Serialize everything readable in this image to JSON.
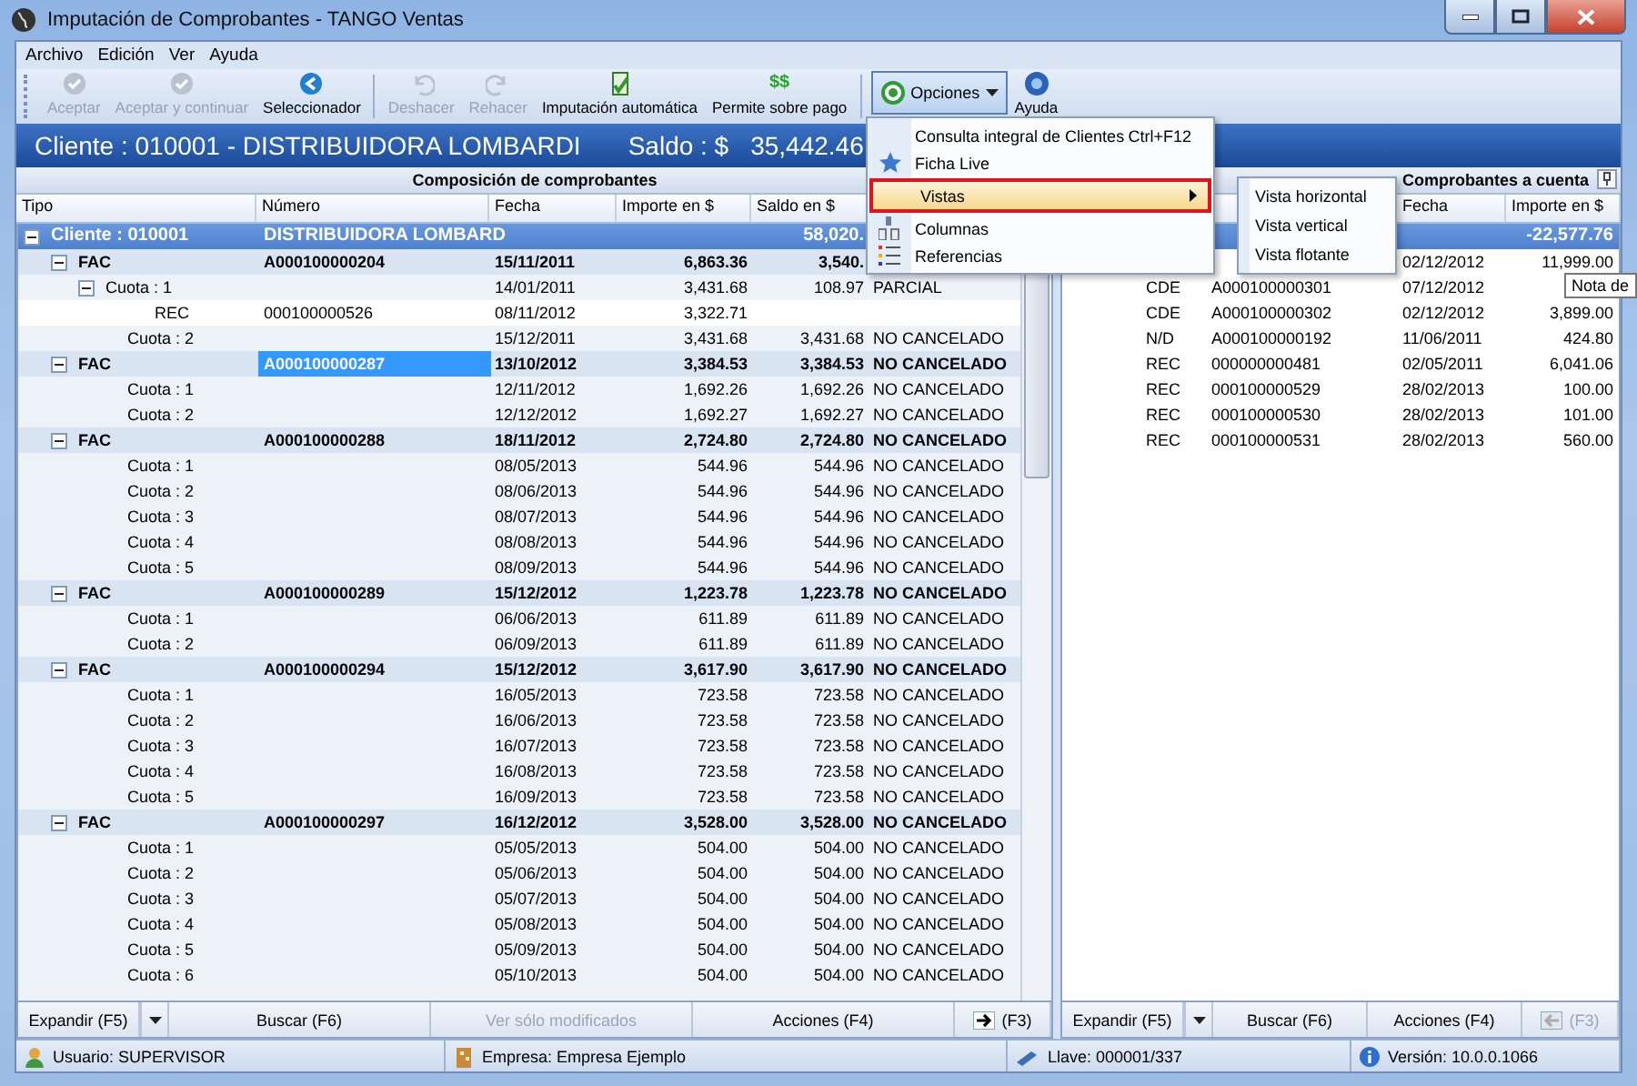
{
  "window": {
    "title": "Imputación de Comprobantes - TANGO Ventas"
  },
  "menu": [
    "Archivo",
    "Edición",
    "Ver",
    "Ayuda"
  ],
  "toolbar": [
    {
      "kind": "button",
      "label": "Aceptar",
      "disabled": true
    },
    {
      "kind": "button",
      "label": "Aceptar y continuar",
      "disabled": true
    },
    {
      "kind": "button",
      "label": "Seleccionador",
      "disabled": false
    },
    {
      "kind": "separator"
    },
    {
      "kind": "button",
      "label": "Deshacer",
      "disabled": true
    },
    {
      "kind": "button",
      "label": "Rehacer",
      "disabled": true
    },
    {
      "kind": "button",
      "label": "Imputación automática",
      "disabled": false
    },
    {
      "kind": "button",
      "label": "Permite sobre pago",
      "glyph": "$$",
      "disabled": false
    },
    {
      "kind": "separator"
    },
    {
      "kind": "menu-button",
      "label": "Opciones",
      "expanded": true
    },
    {
      "kind": "button",
      "label": "Ayuda",
      "disabled": false
    }
  ],
  "client_banner": {
    "client": "Cliente : 010001 - DISTRIBUIDORA LOMBARDI",
    "balance_label": "Saldo : $",
    "balance": "35,442.46"
  },
  "left_panel": {
    "title": "Composición de comprobantes",
    "columns": [
      "Tipo",
      "Número",
      "Fecha",
      "Importe en $",
      "Saldo en $"
    ],
    "rows": [
      {
        "kind": "client",
        "tipo": "Cliente : 010001",
        "numero": "DISTRIBUIDORA LOMBARD",
        "saldo": "58,020.",
        "expanded": true,
        "selected": false,
        "children": [
          {
            "kind": "document",
            "tipo": "FAC",
            "numero": "A000100000204",
            "fecha": "15/11/2011",
            "importe": "6,863.36",
            "saldo": "3,540.",
            "expanded": true,
            "selected": false,
            "children": [
              {
                "kind": "installment",
                "tipo": "Cuota : 1",
                "fecha": "14/01/2011",
                "importe": "3,431.68",
                "saldo": "108.97",
                "estado": "PARCIAL",
                "expanded": true,
                "selected": false,
                "children": [
                  {
                    "kind": "receipt",
                    "tipo": "REC",
                    "numero": "000100000526",
                    "fecha": "08/11/2012",
                    "importe": "3,322.71",
                    "selected": false
                  }
                ]
              },
              {
                "kind": "installment",
                "tipo": "Cuota : 2",
                "fecha": "15/12/2011",
                "importe": "3,431.68",
                "saldo": "3,431.68",
                "estado": "NO CANCELADO",
                "selected": false
              }
            ]
          },
          {
            "kind": "document",
            "tipo": "FAC",
            "numero": "A000100000287",
            "fecha": "13/10/2012",
            "importe": "3,384.53",
            "saldo": "3,384.53",
            "estado": "NO CANCELADO",
            "expanded": true,
            "selected": true,
            "children": [
              {
                "kind": "installment",
                "tipo": "Cuota : 1",
                "fecha": "12/11/2012",
                "importe": "1,692.26",
                "saldo": "1,692.26",
                "estado": "NO CANCELADO",
                "selected": false
              },
              {
                "kind": "installment",
                "tipo": "Cuota : 2",
                "fecha": "12/12/2012",
                "importe": "1,692.27",
                "saldo": "1,692.27",
                "estado": "NO CANCELADO",
                "selected": false
              }
            ]
          },
          {
            "kind": "document",
            "tipo": "FAC",
            "numero": "A000100000288",
            "fecha": "18/11/2012",
            "importe": "2,724.80",
            "saldo": "2,724.80",
            "estado": "NO CANCELADO",
            "expanded": true,
            "selected": false,
            "children": [
              {
                "kind": "installment",
                "tipo": "Cuota : 1",
                "fecha": "08/05/2013",
                "importe": "544.96",
                "saldo": "544.96",
                "estado": "NO CANCELADO",
                "selected": false
              },
              {
                "kind": "installment",
                "tipo": "Cuota : 2",
                "fecha": "08/06/2013",
                "importe": "544.96",
                "saldo": "544.96",
                "estado": "NO CANCELADO",
                "selected": false
              },
              {
                "kind": "installment",
                "tipo": "Cuota : 3",
                "fecha": "08/07/2013",
                "importe": "544.96",
                "saldo": "544.96",
                "estado": "NO CANCELADO",
                "selected": false
              },
              {
                "kind": "installment",
                "tipo": "Cuota : 4",
                "fecha": "08/08/2013",
                "importe": "544.96",
                "saldo": "544.96",
                "estado": "NO CANCELADO",
                "selected": false
              },
              {
                "kind": "installment",
                "tipo": "Cuota : 5",
                "fecha": "08/09/2013",
                "importe": "544.96",
                "saldo": "544.96",
                "estado": "NO CANCELADO",
                "selected": false
              }
            ]
          },
          {
            "kind": "document",
            "tipo": "FAC",
            "numero": "A000100000289",
            "fecha": "15/12/2012",
            "importe": "1,223.78",
            "saldo": "1,223.78",
            "estado": "NO CANCELADO",
            "expanded": true,
            "selected": false,
            "children": [
              {
                "kind": "installment",
                "tipo": "Cuota : 1",
                "fecha": "06/06/2013",
                "importe": "611.89",
                "saldo": "611.89",
                "estado": "NO CANCELADO",
                "selected": false
              },
              {
                "kind": "installment",
                "tipo": "Cuota : 2",
                "fecha": "06/09/2013",
                "importe": "611.89",
                "saldo": "611.89",
                "estado": "NO CANCELADO",
                "selected": false
              }
            ]
          },
          {
            "kind": "document",
            "tipo": "FAC",
            "numero": "A000100000294",
            "fecha": "15/12/2012",
            "importe": "3,617.90",
            "saldo": "3,617.90",
            "estado": "NO CANCELADO",
            "expanded": true,
            "selected": false,
            "children": [
              {
                "kind": "installment",
                "tipo": "Cuota : 1",
                "fecha": "16/05/2013",
                "importe": "723.58",
                "saldo": "723.58",
                "estado": "NO CANCELADO",
                "selected": false
              },
              {
                "kind": "installment",
                "tipo": "Cuota : 2",
                "fecha": "16/06/2013",
                "importe": "723.58",
                "saldo": "723.58",
                "estado": "NO CANCELADO",
                "selected": false
              },
              {
                "kind": "installment",
                "tipo": "Cuota : 3",
                "fecha": "16/07/2013",
                "importe": "723.58",
                "saldo": "723.58",
                "estado": "NO CANCELADO",
                "selected": false
              },
              {
                "kind": "installment",
                "tipo": "Cuota : 4",
                "fecha": "16/08/2013",
                "importe": "723.58",
                "saldo": "723.58",
                "estado": "NO CANCELADO",
                "selected": false
              },
              {
                "kind": "installment",
                "tipo": "Cuota : 5",
                "fecha": "16/09/2013",
                "importe": "723.58",
                "saldo": "723.58",
                "estado": "NO CANCELADO",
                "selected": false
              }
            ]
          },
          {
            "kind": "document",
            "tipo": "FAC",
            "numero": "A000100000297",
            "fecha": "16/12/2012",
            "importe": "3,528.00",
            "saldo": "3,528.00",
            "estado": "NO CANCELADO",
            "expanded": true,
            "selected": false,
            "children": [
              {
                "kind": "installment",
                "tipo": "Cuota : 1",
                "fecha": "05/05/2013",
                "importe": "504.00",
                "saldo": "504.00",
                "estado": "NO CANCELADO",
                "selected": false
              },
              {
                "kind": "installment",
                "tipo": "Cuota : 2",
                "fecha": "05/06/2013",
                "importe": "504.00",
                "saldo": "504.00",
                "estado": "NO CANCELADO",
                "selected": false
              },
              {
                "kind": "installment",
                "tipo": "Cuota : 3",
                "fecha": "05/07/2013",
                "importe": "504.00",
                "saldo": "504.00",
                "estado": "NO CANCELADO",
                "selected": false
              },
              {
                "kind": "installment",
                "tipo": "Cuota : 4",
                "fecha": "05/08/2013",
                "importe": "504.00",
                "saldo": "504.00",
                "estado": "NO CANCELADO",
                "selected": false
              },
              {
                "kind": "installment",
                "tipo": "Cuota : 5",
                "fecha": "05/09/2013",
                "importe": "504.00",
                "saldo": "504.00",
                "estado": "NO CANCELADO",
                "selected": false
              },
              {
                "kind": "installment",
                "tipo": "Cuota : 6",
                "fecha": "05/10/2013",
                "importe": "504.00",
                "saldo": "504.00",
                "estado": "NO CANCELADO",
                "selected": false
              }
            ]
          }
        ]
      }
    ],
    "buttons": [
      {
        "kind": "split",
        "label": "Expandir (F5)",
        "disabled": false
      },
      {
        "kind": "plain",
        "label": "Buscar (F6)",
        "disabled": false
      },
      {
        "kind": "plain",
        "label": "Ver sólo modificados",
        "disabled": true
      },
      {
        "kind": "plain",
        "label": "Acciones (F4)",
        "disabled": false
      },
      {
        "kind": "arrow-right",
        "label": "(F3)",
        "disabled": false
      }
    ]
  },
  "right_panel": {
    "title": "Comprobantes a cuenta",
    "columns": [
      "Fecha",
      "Importe en $"
    ],
    "rows": [
      {
        "kind": "total",
        "importe": "-22,577.76"
      },
      {
        "kind": "item",
        "fecha": "02/12/2012",
        "importe": "11,999.00"
      },
      {
        "kind": "item",
        "tipo": "CDE",
        "numero": "A000100000301",
        "fecha": "07/12/2012"
      },
      {
        "kind": "item",
        "tipo": "CDE",
        "numero": "A000100000302",
        "fecha": "02/12/2012",
        "importe": "3,899.00"
      },
      {
        "kind": "item",
        "tipo": "N/D",
        "numero": "A000100000192",
        "fecha": "11/06/2011",
        "importe": "424.80"
      },
      {
        "kind": "item",
        "tipo": "REC",
        "numero": "000000000481",
        "fecha": "02/05/2011",
        "importe": "6,041.06"
      },
      {
        "kind": "item",
        "tipo": "REC",
        "numero": "000100000529",
        "fecha": "28/02/2013",
        "importe": "100.00"
      },
      {
        "kind": "item",
        "tipo": "REC",
        "numero": "000100000530",
        "fecha": "28/02/2013",
        "importe": "101.00"
      },
      {
        "kind": "item",
        "tipo": "REC",
        "numero": "000100000531",
        "fecha": "28/02/2013",
        "importe": "560.00"
      }
    ],
    "tooltip": "Nota de",
    "buttons": [
      {
        "kind": "split",
        "label": "Expandir (F5)",
        "disabled": false
      },
      {
        "kind": "plain",
        "label": "Buscar (F6)",
        "disabled": false
      },
      {
        "kind": "plain",
        "label": "Acciones (F4)",
        "disabled": false
      },
      {
        "kind": "arrow-left",
        "label": "(F3)",
        "disabled": true
      }
    ]
  },
  "options_menu": {
    "items": [
      {
        "label": "Consulta integral de Clientes",
        "shortcut": "Ctrl+F12",
        "highlighted": false
      },
      {
        "label": "Ficha Live",
        "highlighted": false
      },
      {
        "label": "Vistas",
        "highlighted": true,
        "submenu": true
      },
      {
        "label": "Columnas",
        "highlighted": false
      },
      {
        "label": "Referencias",
        "highlighted": false
      }
    ],
    "submenu_items": [
      "Vista horizontal",
      "Vista vertical",
      "Vista flotante"
    ]
  },
  "status_bar": [
    {
      "text": "Usuario: SUPERVISOR"
    },
    {
      "text": "Empresa: Empresa Ejemplo"
    },
    {
      "text": "Llave: 000001/337"
    },
    {
      "text": "Versión: 10.0.0.1066"
    }
  ]
}
